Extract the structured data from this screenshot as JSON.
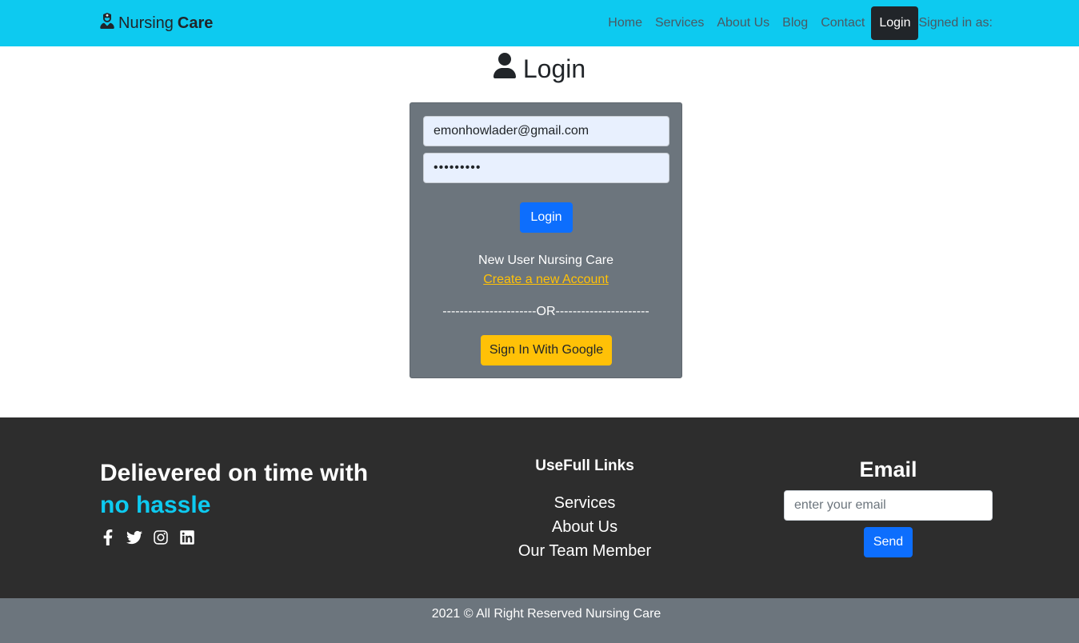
{
  "navbar": {
    "brand_part1": "Nursing",
    "brand_part2": "Care",
    "brand_icon": "nurse-icon",
    "links": [
      "Home",
      "Services",
      "About Us",
      "Blog",
      "Contact"
    ],
    "login_label": "Login",
    "signed_in_text": "Signed in as:",
    "background": "#0dcaf0"
  },
  "login": {
    "title": "Login",
    "title_icon": "user-icon",
    "email_value": "emonhowlader@gmail.com",
    "password_value": "•••••••••",
    "login_button": "Login",
    "new_user_text": "New User Nursing Care",
    "create_account_link": "Create a new Account",
    "divider_text": "----------------------OR----------------------",
    "google_button": "Sign In With Google"
  },
  "footer": {
    "tagline_line1": "Delievered on time with",
    "tagline_line2": "no hassle",
    "socials": [
      "facebook-icon",
      "twitter-icon",
      "instagram-icon",
      "linkedin-icon"
    ],
    "links_title": "UseFull Links",
    "links": [
      "Services",
      "About Us",
      "Our Team Member"
    ],
    "email_title": "Email",
    "email_placeholder": "enter your email",
    "send_button": "Send",
    "copyright": "2021 © All Right Reserved Nursing Care"
  },
  "colors": {
    "accent": "#0dcaf0",
    "primary": "#0d6efd",
    "warning": "#ffc107",
    "dark": "#212529",
    "footer": "#2d2d2d",
    "secondary": "#6c757d"
  }
}
